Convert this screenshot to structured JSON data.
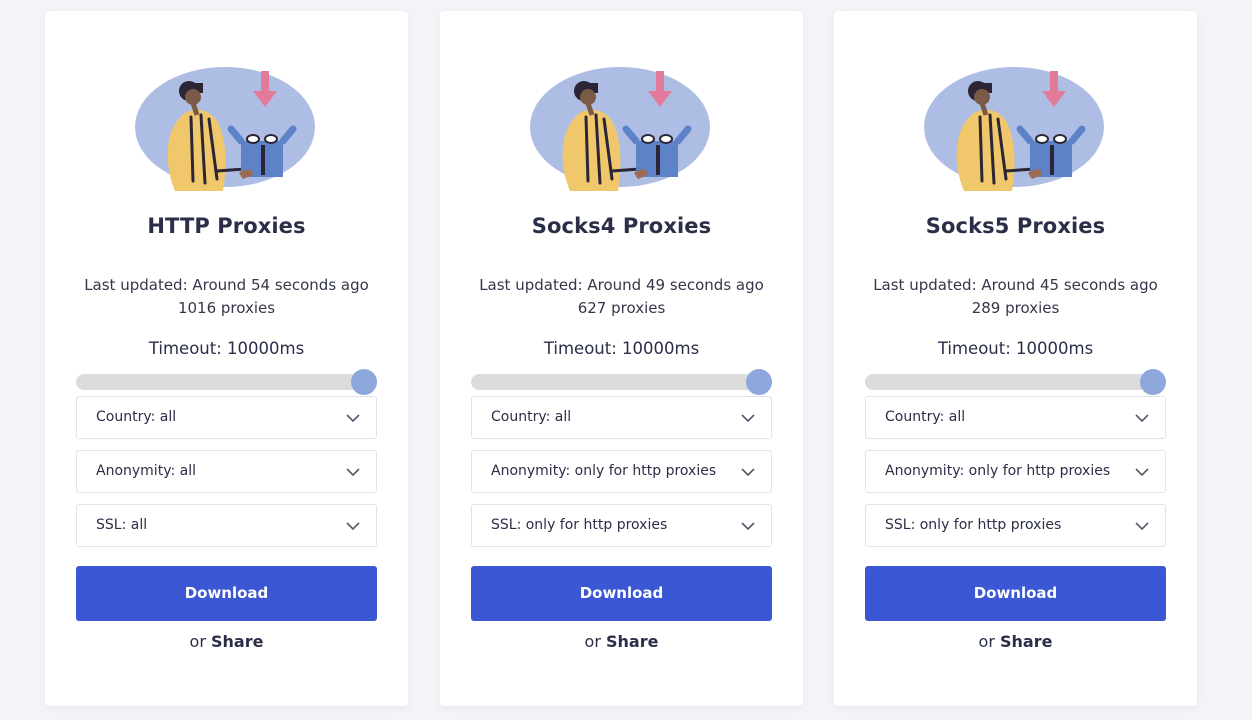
{
  "colors": {
    "page_background": "#f3f4f8",
    "card_background": "#ffffff",
    "accent": "#3b57d3",
    "slider_thumb": "#8ea8de",
    "slider_track": "#dcdcdc",
    "title_text": "#2b2e48"
  },
  "cards": [
    {
      "illustration_icon": "person-unboxing-download-illustration",
      "title": "HTTP Proxies",
      "last_updated": "Last updated: Around 54 seconds ago",
      "count": "1016 proxies",
      "timeout_label": "Timeout: 10000ms",
      "timeout_slider_fraction": 1.0,
      "country": "Country: all",
      "anonymity": "Anonymity: all",
      "ssl": "SSL: all",
      "download_label": "Download",
      "or_text": "or",
      "share_label": "Share"
    },
    {
      "illustration_icon": "person-unboxing-download-illustration",
      "title": "Socks4 Proxies",
      "last_updated": "Last updated: Around 49 seconds ago",
      "count": "627 proxies",
      "timeout_label": "Timeout: 10000ms",
      "timeout_slider_fraction": 1.0,
      "country": "Country: all",
      "anonymity": "Anonymity: only for http proxies",
      "ssl": "SSL: only for http proxies",
      "download_label": "Download",
      "or_text": "or",
      "share_label": "Share"
    },
    {
      "illustration_icon": "person-unboxing-download-illustration",
      "title": "Socks5 Proxies",
      "last_updated": "Last updated: Around 45 seconds ago",
      "count": "289 proxies",
      "timeout_label": "Timeout: 10000ms",
      "timeout_slider_fraction": 1.0,
      "country": "Country: all",
      "anonymity": "Anonymity: only for http proxies",
      "ssl": "SSL: only for http proxies",
      "download_label": "Download",
      "or_text": "or",
      "share_label": "Share"
    }
  ]
}
